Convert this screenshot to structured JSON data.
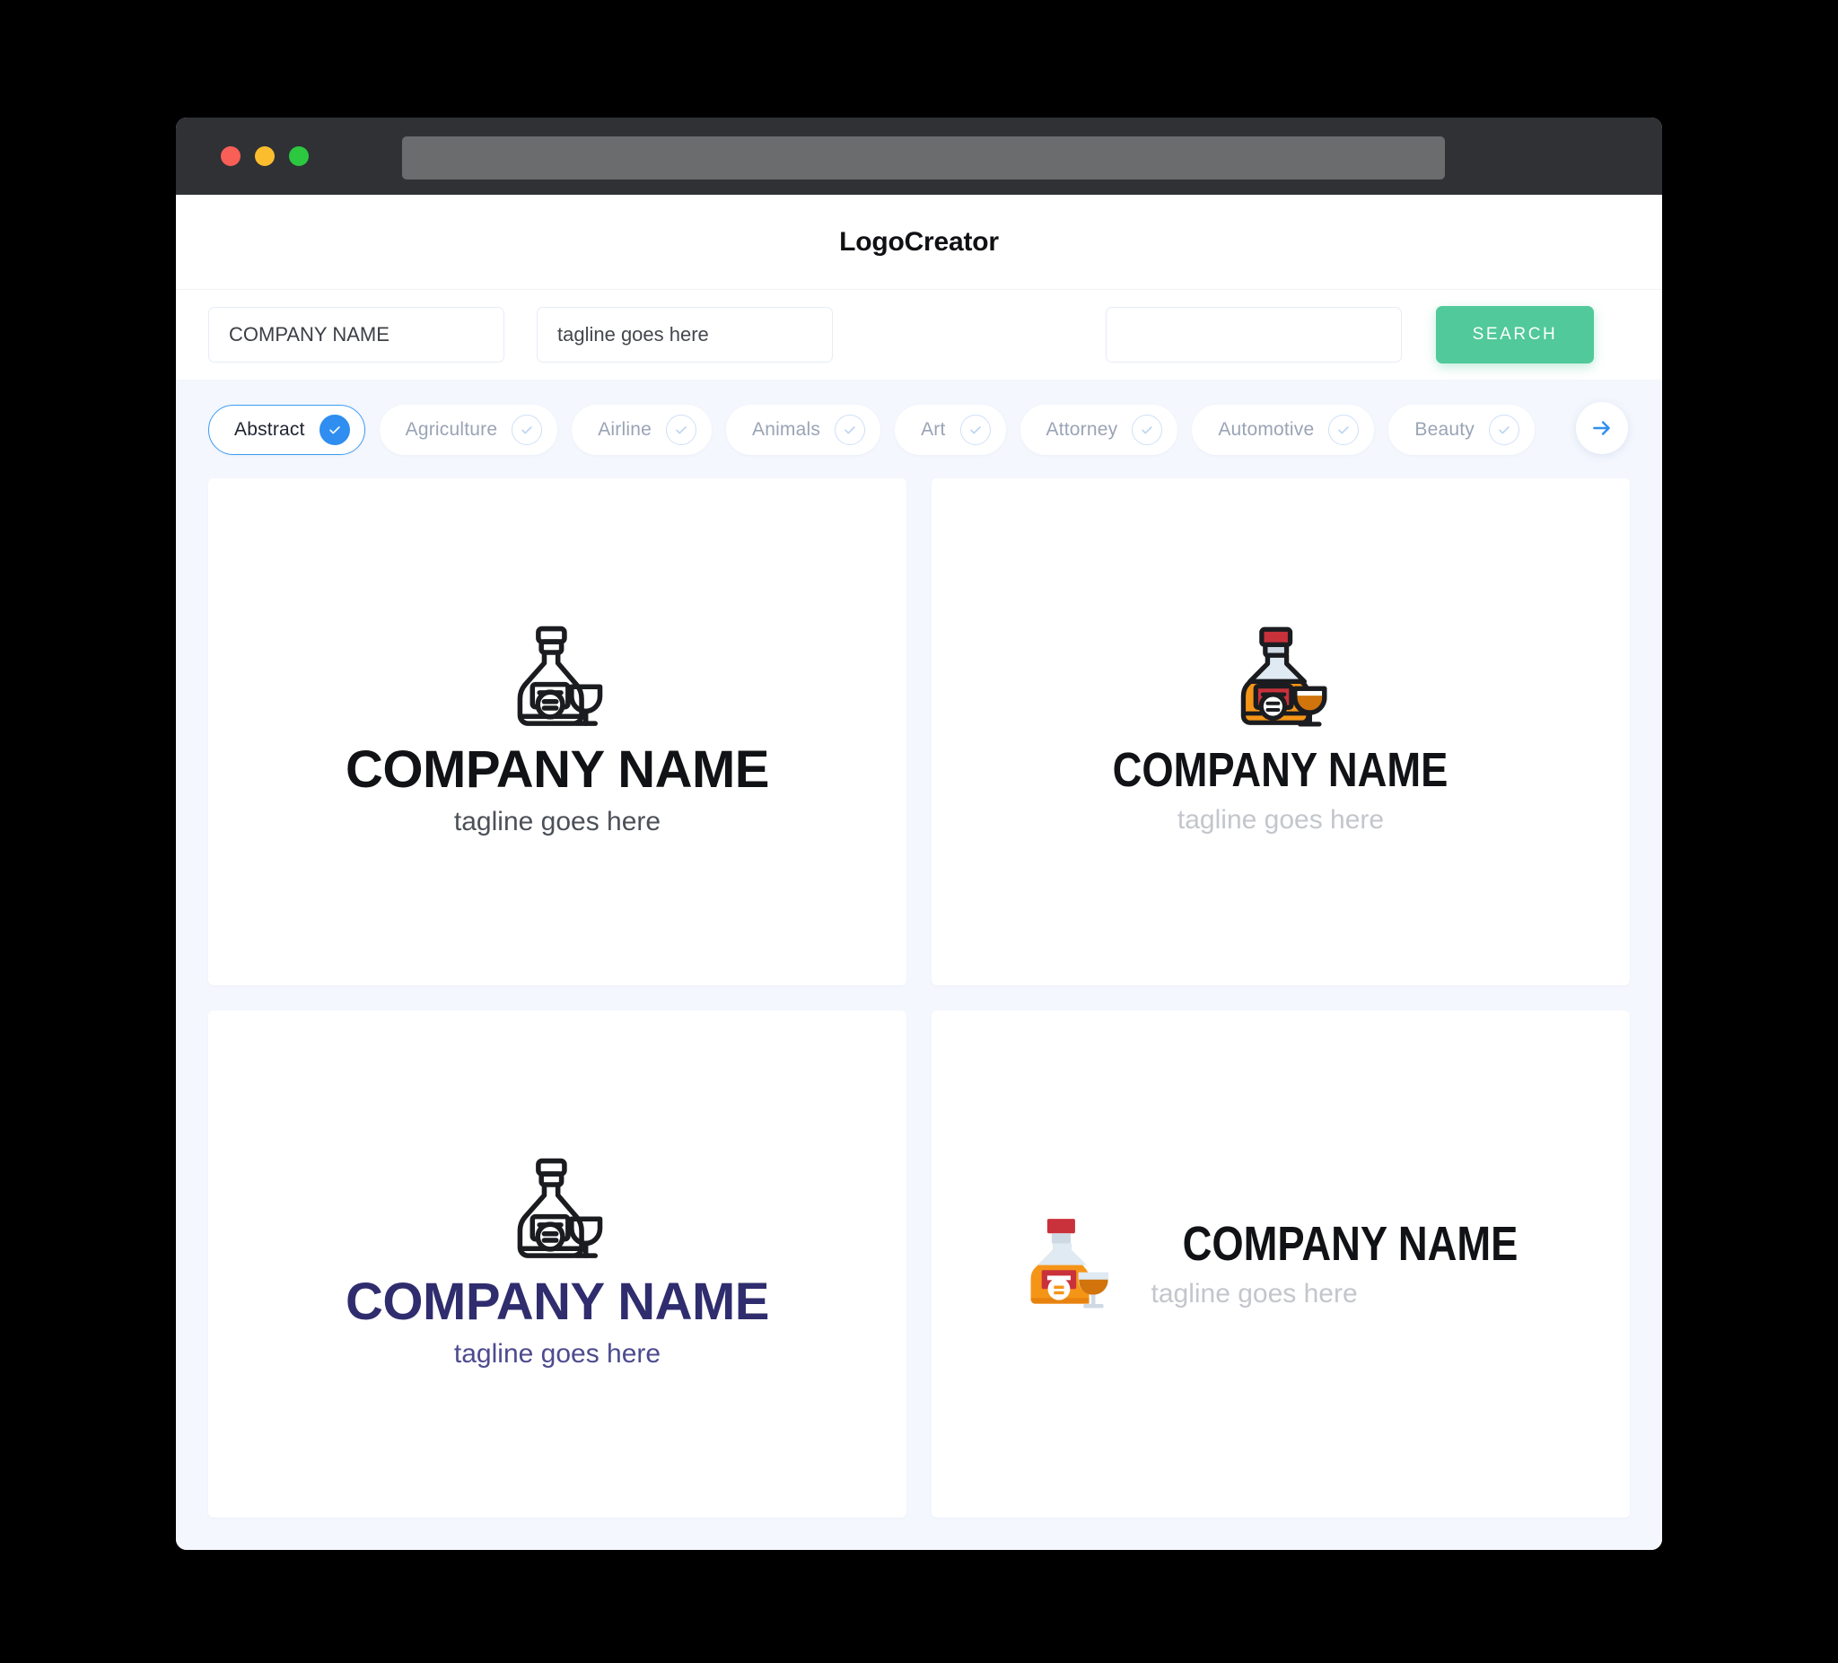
{
  "window": {
    "traffic_lights": [
      "close",
      "minimize",
      "maximize"
    ],
    "url_value": ""
  },
  "header": {
    "title": "LogoCreator"
  },
  "search": {
    "company_value": "COMPANY NAME",
    "company_placeholder": "COMPANY NAME",
    "tagline_value": "tagline goes here",
    "tagline_placeholder": "tagline goes here",
    "extra_value": "",
    "extra_placeholder": "",
    "button_label": "SEARCH",
    "button_color": "#51c99a"
  },
  "categories": {
    "next_arrow_icon": "arrow-right-icon",
    "accent_color": "#2f8ef0",
    "items": [
      {
        "label": "Abstract",
        "selected": true
      },
      {
        "label": "Agriculture",
        "selected": false
      },
      {
        "label": "Airline",
        "selected": false
      },
      {
        "label": "Animals",
        "selected": false
      },
      {
        "label": "Art",
        "selected": false
      },
      {
        "label": "Attorney",
        "selected": false
      },
      {
        "label": "Automotive",
        "selected": false
      },
      {
        "label": "Beauty",
        "selected": false
      }
    ]
  },
  "results": [
    {
      "id": "logo-1",
      "layout": "stacked",
      "icon": "decanter-and-glass-outline-icon",
      "style": "outline-black",
      "company": "COMPANY NAME",
      "tagline": "tagline goes here",
      "company_color": "#111215",
      "tagline_color": "#4c5058"
    },
    {
      "id": "logo-2",
      "layout": "stacked",
      "icon": "decanter-and-glass-color-icon",
      "style": "color-outlined",
      "company": "COMPANY NAME",
      "tagline": "tagline goes here",
      "company_color": "#111215",
      "tagline_color": "#c3c6cb"
    },
    {
      "id": "logo-3",
      "layout": "stacked",
      "icon": "decanter-and-glass-outline-icon",
      "style": "outline-black",
      "company": "COMPANY NAME",
      "tagline": "tagline goes here",
      "company_color": "#2f2d6e",
      "tagline_color": "#4d4b8f"
    },
    {
      "id": "logo-4",
      "layout": "horizontal",
      "icon": "decanter-and-glass-flat-icon",
      "style": "color-flat",
      "company": "COMPANY NAME",
      "tagline": "tagline goes here",
      "company_color": "#111215",
      "tagline_color": "#c3c6cb"
    }
  ],
  "palette": {
    "page_background": "#f4f7fd",
    "card_background": "#ffffff",
    "titlebar": "#2f3135",
    "urlbar": "#6a6c6e",
    "bottle_orange": "#f59517",
    "bottle_orange_dark": "#e8820f",
    "bottle_cap_red": "#c9313b",
    "bottle_neck": "#ced9e4",
    "bottle_glass": "#dfeaf3",
    "label_red": "#c9313b",
    "drink_amber": "#d1740b"
  }
}
